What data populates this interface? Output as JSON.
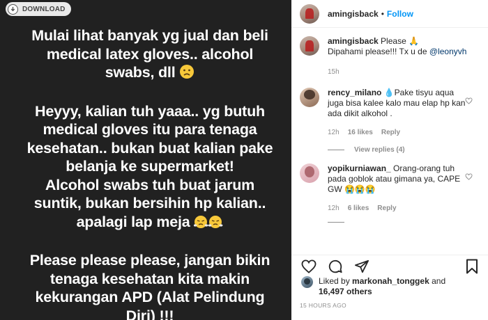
{
  "download": {
    "label": "DOWNLOAD",
    "icon": "download-icon"
  },
  "post_image": {
    "paragraphs": [
      {
        "lines": [
          "Mulai lihat banyak yg jual dan beli",
          "medical latex gloves.. alcohol",
          "swabs, dll"
        ],
        "emoji": "worried-face"
      },
      {
        "lines": [
          "Heyyy, kalian tuh yaaa.. yg butuh",
          "medical gloves itu para tenaga",
          "kesehatan.. bukan buat kalian pake",
          "belanja ke supermarket!",
          "Alcohol swabs tuh buat jarum",
          "suntik, bukan bersihin hp kalian..",
          "apalagi lap meja"
        ],
        "emoji": "steam-face x2"
      },
      {
        "lines": [
          "Please please please, jangan bikin",
          "tenaga kesehatan kita makin",
          "kekurangan APD (Alat Pelindung",
          "Diri) !!!"
        ]
      }
    ]
  },
  "header": {
    "username": "amingisback",
    "separator": "•",
    "follow_label": "Follow"
  },
  "caption": {
    "username": "amingisback",
    "text_1": "Please 🙏",
    "text_2": "Dipahami please!!! Tx u de",
    "mention": "@leonyvh",
    "time": "15h"
  },
  "comments": [
    {
      "username": "rency_milano",
      "text": "💧Pake tisyu aqua juga bisa kalee kalo mau elap hp kan ada dikit alkohol .",
      "time": "12h",
      "likes": "16 likes",
      "reply": "Reply",
      "view_replies": "View replies (4)"
    },
    {
      "username": "yopikurniawan_",
      "text": "Orang-orang tuh pada goblok atau gimana ya, CAPE GW 😭😭😭",
      "time": "12h",
      "likes": "6 likes",
      "reply": "Reply"
    }
  ],
  "actions": {
    "icons": [
      "heart-icon",
      "comment-icon",
      "share-icon",
      "bookmark-icon"
    ]
  },
  "likes": {
    "prefix": "Liked by",
    "user": "markonah_tonggek",
    "and": "and",
    "count": "16,497 others"
  },
  "timestamp": "15 HOURS AGO",
  "colors": {
    "image_bg": "#212121",
    "follow_blue": "#0095f6",
    "mention": "#00376b",
    "muted": "#8e8e8e"
  }
}
